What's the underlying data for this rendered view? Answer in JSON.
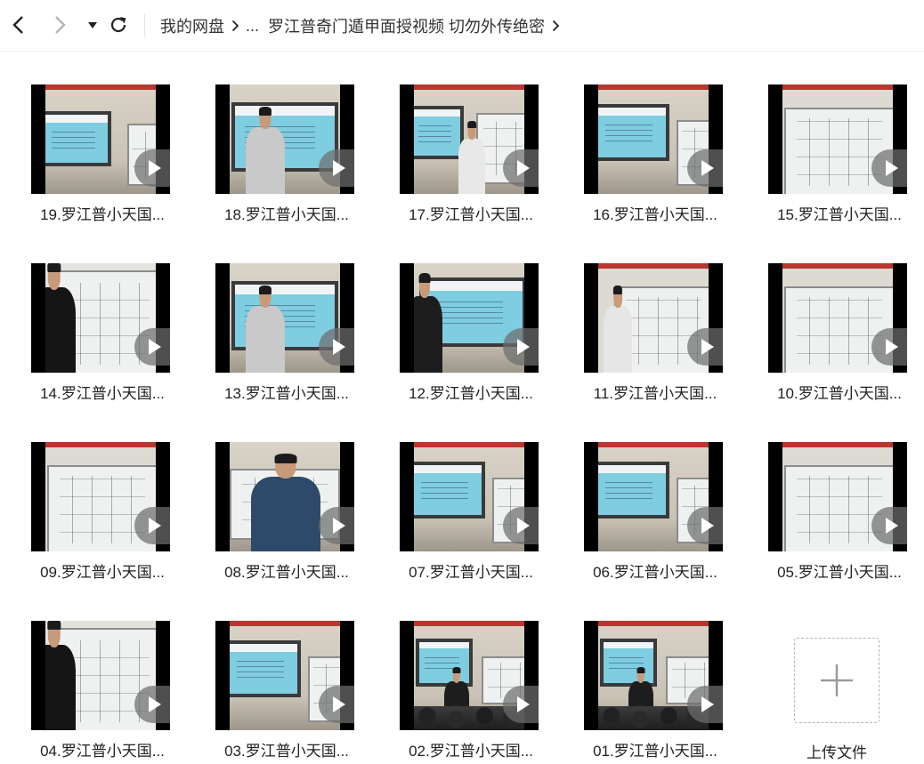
{
  "breadcrumb": {
    "root": "我的网盘",
    "ellipsis": "...",
    "folder": "罗江普奇门遁甲面授视频 切勿外传绝密"
  },
  "videos": [
    {
      "label": "19.罗江普小天国...",
      "scene": "screen"
    },
    {
      "label": "18.罗江普小天国...",
      "scene": "speaker-screen"
    },
    {
      "label": "17.罗江普小天国...",
      "scene": "screen-writer"
    },
    {
      "label": "16.罗江普小天国...",
      "scene": "screen-board"
    },
    {
      "label": "15.罗江普小天国...",
      "scene": "board"
    },
    {
      "label": "14.罗江普小天国...",
      "scene": "board-closeup"
    },
    {
      "label": "13.罗江普小天国...",
      "scene": "speaker-screen"
    },
    {
      "label": "12.罗江普小天国...",
      "scene": "screen-left-person"
    },
    {
      "label": "11.罗江普小天国...",
      "scene": "board-writer"
    },
    {
      "label": "10.罗江普小天国...",
      "scene": "board"
    },
    {
      "label": "09.罗江普小天国...",
      "scene": "board"
    },
    {
      "label": "08.罗江普小天国...",
      "scene": "speaker-board"
    },
    {
      "label": "07.罗江普小天国...",
      "scene": "screen-board"
    },
    {
      "label": "06.罗江普小天国...",
      "scene": "screen-board"
    },
    {
      "label": "05.罗江普小天国...",
      "scene": "board"
    },
    {
      "label": "04.罗江普小天国...",
      "scene": "board-closeup"
    },
    {
      "label": "03.罗江普小天国...",
      "scene": "screen-board"
    },
    {
      "label": "02.罗江普小天国...",
      "scene": "classroom"
    },
    {
      "label": "01.罗江普小天国...",
      "scene": "classroom"
    }
  ],
  "upload": {
    "label": "上传文件"
  },
  "colors": {
    "accent_red": "#b8372e",
    "screen_blue": "#7ecde0",
    "play_overlay": "#6e6e6e"
  }
}
